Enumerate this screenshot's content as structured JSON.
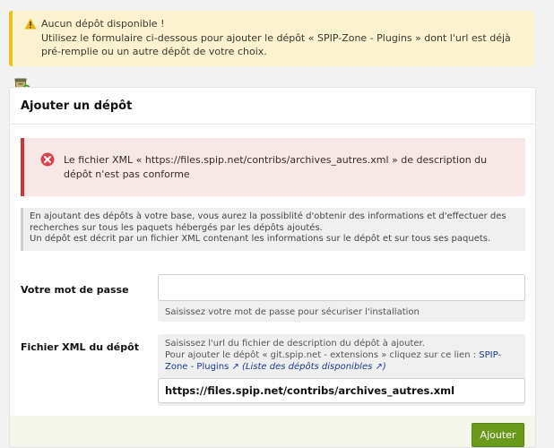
{
  "notice": {
    "title": "Aucun dépôt disponible !",
    "message": "Utilisez le formulaire ci-dessous pour ajouter le dépôt « SPIP-Zone - Plugins » dont l'url est déjà pré-remplie ou un autre dépôt de votre choix."
  },
  "panel": {
    "title": "Ajouter un dépôt"
  },
  "error": {
    "message": "Le fichier XML « https://files.spip.net/contribs/archives_autres.xml » de description du dépôt n'est pas conforme"
  },
  "info": {
    "line1": "En ajoutant des dépôts à votre base, vous aurez la possiblité d'obtenir des informations et d'effectuer des recherches sur tous les paquets hébergés par les dépôts ajoutés.",
    "line2": "Un dépôt est décrit par un fichier XML contenant les informations sur le dépôt et sur tous ses paquets."
  },
  "password": {
    "label": "Votre mot de passe",
    "value": "",
    "help": "Saisissez votre mot de passe pour sécuriser l'installation"
  },
  "xml": {
    "label": "Fichier XML du dépôt",
    "help_line1": "Saisissez l'url du fichier de description du dépôt à ajouter.",
    "help_line2_prefix": "Pour ajouter le dépôt « git.spip.net - extensions » cliquez sur ce lien : ",
    "help_link": "SPIP-Zone - Plugins",
    "help_link2": "Liste des dépôts disponibles",
    "value": "https://files.spip.net/contribs/archives_autres.xml"
  },
  "submit_label": "Ajouter",
  "colors": {
    "notice_bg": "#fbf3d0",
    "notice_accent": "#f0c020",
    "error_bg": "#f8e7e7",
    "error_accent": "#d0343a",
    "button": "#6a9a1c"
  }
}
